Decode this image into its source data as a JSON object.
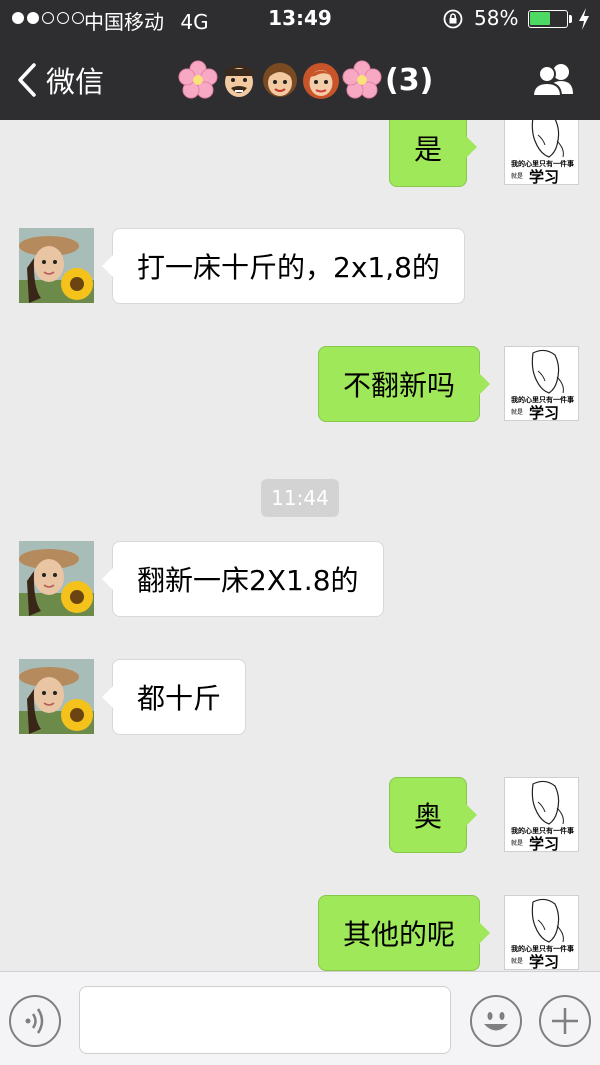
{
  "status_bar": {
    "carrier": "中国移动",
    "network": "4G",
    "time": "13:49",
    "battery_percent": "58%",
    "battery_level": 0.58,
    "signal_bars": 2,
    "signal_total": 5
  },
  "nav": {
    "back_label": "微信",
    "title_emojis": [
      "cherry-blossom-icon",
      "man-face-icon",
      "girl-face-icon",
      "woman-face-icon",
      "cherry-blossom-icon"
    ],
    "member_count": "(3)"
  },
  "messages": [
    {
      "direction": "out",
      "text": "是"
    },
    {
      "direction": "in",
      "text": "打一床十斤的，2x1,8的"
    },
    {
      "direction": "out",
      "text": "不翻新吗"
    },
    {
      "direction": "in",
      "text": "翻新一床2X1.8的"
    },
    {
      "direction": "in",
      "text": "都十斤"
    },
    {
      "direction": "out",
      "text": "奥"
    },
    {
      "direction": "out",
      "text": "其他的呢"
    }
  ],
  "timestamp": "11:44",
  "meme": {
    "caption": "我的心里只有一件事",
    "small": "就是",
    "big": "学习"
  },
  "colors": {
    "topbar": "#2e2e30",
    "outgoing_bubble": "#9fe85a",
    "incoming_bubble": "#ffffff",
    "chat_background": "#ebebeb",
    "battery_fill": "#4cd964"
  }
}
